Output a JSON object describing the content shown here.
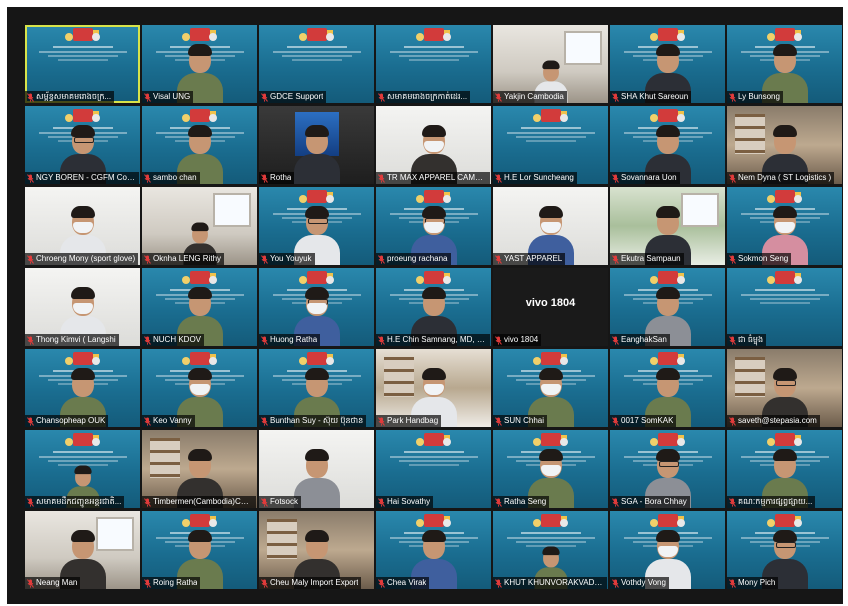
{
  "meeting": {
    "participants": [
      {
        "name": "សម្ព័ន្ធសមាគមរោងចក្រ...",
        "scene": "banner",
        "active": true
      },
      {
        "name": "Visal UNG",
        "scene": "banner",
        "person": "uniform"
      },
      {
        "name": "GDCE Support",
        "scene": "banner"
      },
      {
        "name": "សមាគមរោងចក្រកាត់ដេរ...",
        "scene": "banner"
      },
      {
        "name": "Yakjin Cambodia",
        "scene": "office",
        "person": "shirt-white",
        "small": true
      },
      {
        "name": "SHA Khut Sareoun",
        "scene": "banner",
        "person": "suit"
      },
      {
        "name": "Ly Bunsong",
        "scene": "banner",
        "person": "uniform"
      },
      {
        "name": "NGY BOREN - CGFM Co., Ltd",
        "scene": "banner",
        "person": "suit",
        "glasses": true
      },
      {
        "name": "sambo chan",
        "scene": "banner",
        "person": "uniform"
      },
      {
        "name": "Rotha",
        "scene": "dark",
        "person": "suit",
        "screen": true
      },
      {
        "name": "TR MAX APPAREL CAMBODIA",
        "scene": "white",
        "person": "shirt-dark",
        "mask": true
      },
      {
        "name": "H.E Lor Suncheang",
        "scene": "banner"
      },
      {
        "name": "Sovannara Uon",
        "scene": "banner",
        "person": "suit"
      },
      {
        "name": "Nem Dyna ( ST Logistics )",
        "scene": "room",
        "person": "suit"
      },
      {
        "name": "Chroeng Mony (sport glove)",
        "scene": "white",
        "person": "shirt-white",
        "mask": true
      },
      {
        "name": "Oknha LENG Rithy",
        "scene": "office",
        "person": "shirt-dark",
        "small": true
      },
      {
        "name": "You Youyuk",
        "scene": "banner",
        "person": "shirt-white",
        "glasses": true
      },
      {
        "name": "proeung rachana",
        "scene": "banner",
        "person": "shirt-blue",
        "mask": true,
        "glasses": true
      },
      {
        "name": "YAST APPAREL",
        "scene": "white",
        "person": "shirt-blue",
        "mask": true
      },
      {
        "name": "Ekutra Sampaun",
        "scene": "window",
        "person": "suit"
      },
      {
        "name": "Sokmon Seng",
        "scene": "banner",
        "person": "shirt-pink",
        "mask": true
      },
      {
        "name": "Thong Kimvi ( Langshi",
        "scene": "white",
        "person": "shirt-white",
        "mask": true
      },
      {
        "name": "NUCH KDOV",
        "scene": "banner",
        "person": "uniform"
      },
      {
        "name": "Huong Ratha",
        "scene": "banner",
        "person": "shirt-blue",
        "mask": true,
        "glasses": true
      },
      {
        "name": "H.E Chin Samnang, MD, MPH",
        "scene": "banner",
        "person": "suit"
      },
      {
        "name": "vivo 1804",
        "scene": "black",
        "label": "vivo 1804"
      },
      {
        "name": "EanghakSan",
        "scene": "banner",
        "person": "shirt-grey"
      },
      {
        "name": "ជា ធំម្ចុង",
        "scene": "banner"
      },
      {
        "name": "Chansopheap OUK",
        "scene": "banner",
        "person": "uniform"
      },
      {
        "name": "Keo Vanny",
        "scene": "banner",
        "person": "uniform",
        "mask": true
      },
      {
        "name": "Bunthan Suy - ស៊ុយ ប៊ុនថាន",
        "scene": "banner",
        "person": "uniform"
      },
      {
        "name": "Park Handbag",
        "scene": "shelf",
        "person": "shirt-white",
        "mask": true
      },
      {
        "name": "SUN Chhai",
        "scene": "banner",
        "person": "uniform",
        "mask": true
      },
      {
        "name": "0017 SomKAK",
        "scene": "banner",
        "person": "uniform"
      },
      {
        "name": "saveth@stepasia.com",
        "scene": "room",
        "person": "shirt-dark",
        "glasses": true
      },
      {
        "name": "សមាគមដឹកជញ្ជូនអន្តរជាតិ...",
        "scene": "banner",
        "person": "uniform",
        "small": true
      },
      {
        "name": "Timbermen(Cambodia)Co.,Ltd",
        "scene": "room",
        "person": "shirt-dark"
      },
      {
        "name": "Fotsock",
        "scene": "white",
        "person": "shirt-grey"
      },
      {
        "name": "Hai Sovathy",
        "scene": "banner"
      },
      {
        "name": "Ratha Seng",
        "scene": "banner",
        "person": "uniform",
        "mask": true
      },
      {
        "name": "SGA - Bora Chhay",
        "scene": "banner",
        "person": "shirt-grey",
        "glasses": true
      },
      {
        "name": "គណៈកម្មការផ្សព្វផ្សាយ...",
        "scene": "banner",
        "person": "uniform"
      },
      {
        "name": "Neang Man",
        "scene": "office",
        "person": "shirt-dark"
      },
      {
        "name": "Roing Ratha",
        "scene": "banner",
        "person": "uniform"
      },
      {
        "name": "Cheu Maly Import Export",
        "scene": "room",
        "person": "shirt-dark"
      },
      {
        "name": "Chea Virak",
        "scene": "banner",
        "person": "shirt-blue"
      },
      {
        "name": "KHUT KHUNVORAKVADH (G...",
        "scene": "banner",
        "person": "uniform",
        "small": true
      },
      {
        "name": "Vothdy Vong",
        "scene": "banner",
        "person": "shirt-white",
        "mask": true
      },
      {
        "name": "Mony Pich",
        "scene": "banner",
        "person": "suit",
        "glasses": true
      }
    ]
  }
}
